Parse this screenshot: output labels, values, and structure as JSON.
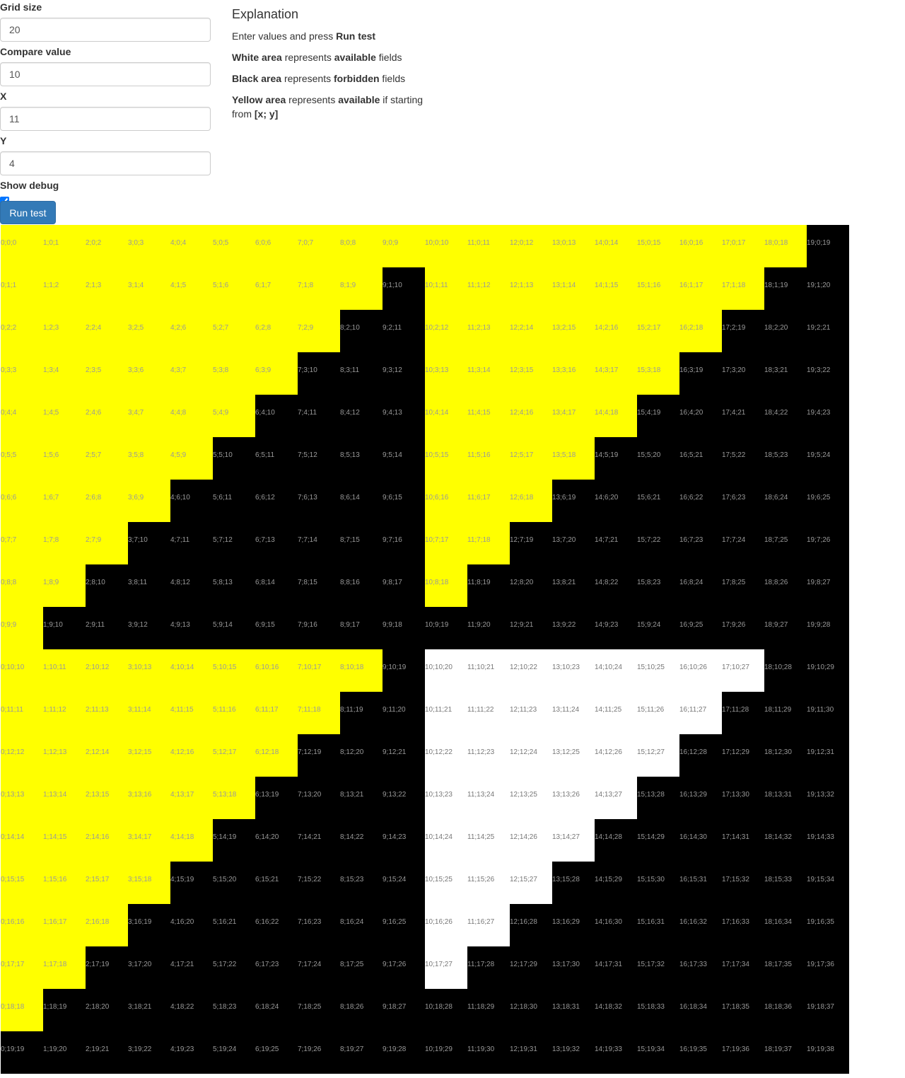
{
  "form": {
    "grid_size_label": "Grid size",
    "grid_size_value": "20",
    "compare_value_label": "Compare value",
    "compare_value_value": "10",
    "x_label": "X",
    "x_value": "11",
    "y_label": "Y",
    "y_value": "4",
    "show_debug_label": "Show debug",
    "show_debug_checked": true,
    "run_button_label": "Run test"
  },
  "explanation": {
    "title": "Explanation",
    "line1_pre": "Enter values and press ",
    "line1_bold": "Run test",
    "line2_bold1": "White area",
    "line2_mid": " represents ",
    "line2_bold2": "available",
    "line2_post": " fields",
    "line3_bold1": "Black area",
    "line3_mid": " represents ",
    "line3_bold2": "forbidden",
    "line3_post": " fields",
    "line4_bold1": "Yellow area",
    "line4_mid": " represents ",
    "line4_bold2": "available",
    "line4_post": " if starting from ",
    "line4_bold3": "[x; y]"
  },
  "grid": {
    "size": 20,
    "compare_value": 10,
    "colors": {
      "forbidden": "#000000",
      "available": "#ffffff",
      "reachable": "#ffff00"
    },
    "rows": [
      "YYYYYYYYYYYYYYYYYYYB",
      "YYYYYYYYYBYYYYYYYYBB",
      "YYYYYYYYBBYYYYYYYBBB",
      "YYYYYYYBBBYYYYYYBBBB",
      "YYYYYYBBBBYYYYYBBBBB",
      "YYYYYBBBBBYYYYBBBBBB",
      "YYYYBBBBBBYYYBBBBBBB",
      "YYYBBBBBBBYYBBBBBBBB",
      "YYBBBBBBBBYBBBBBBBBB",
      "YBBBBBBBBBBBBBBBBBBB",
      "YYYYYYYYYBWWWWWWWWBB",
      "YYYYYYYYBBWWWWWWWBBB",
      "YYYYYYYBBBWWWWWWBBBB",
      "YYYYYYBBBBWWWWWBBBBB",
      "YYYYYBBBBBWWWWBBBBBB",
      "YYYYBBBBBBWWWBBBBBBB",
      "YYYBBBBBBBWWBBBBBBBB",
      "YYBBBBBBBBWBBBBBBBBB",
      "YBBBBBBBBBBBBBBBBBBB",
      "BBBBBBBBBBBBBBBBBBBB"
    ]
  }
}
